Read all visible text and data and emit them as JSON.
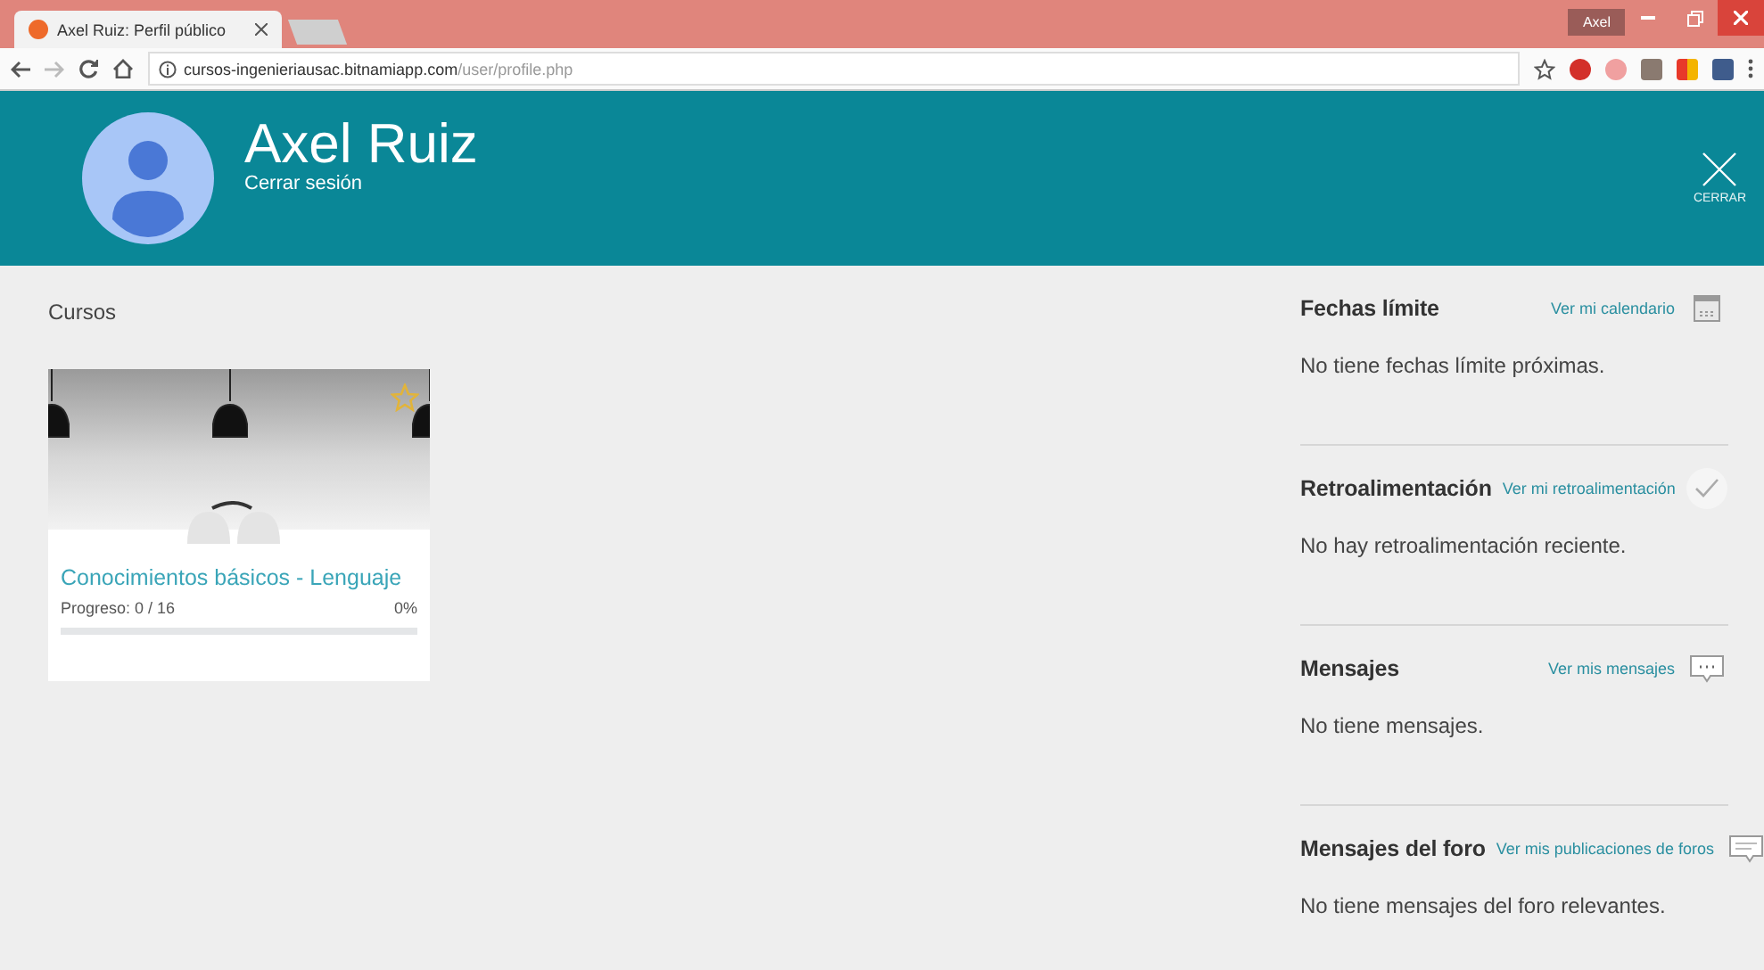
{
  "browser": {
    "tab_title": "Axel Ruiz: Perfil público",
    "user_badge": "Axel",
    "url_host": "cursos-ingenieriausac.bitnamiapp.com",
    "url_path": "/user/profile.php"
  },
  "header": {
    "name": "Axel Ruiz",
    "logout": "Cerrar sesión",
    "close": "CERRAR"
  },
  "courses": {
    "title": "Cursos",
    "items": [
      {
        "name": "Conocimientos básicos - Lenguaje",
        "progress_text": "Progreso: 0 / 16",
        "percent": "0%",
        "level": 0
      }
    ]
  },
  "blocks": [
    {
      "kind": "calendar",
      "title": "Fechas límite",
      "link": "Ver mi calendario",
      "message": "No tiene fechas límite próximas."
    },
    {
      "kind": "check",
      "title": "Retroalimentación",
      "link": "Ver mi retroalimentación",
      "message": "No hay retroalimentación reciente."
    },
    {
      "kind": "chat",
      "title": "Mensajes",
      "link": "Ver mis mensajes",
      "message": "No tiene mensajes."
    },
    {
      "kind": "forum",
      "title": "Mensajes del foro",
      "link": "Ver mis publicaciones de foros",
      "message": "No tiene mensajes del foro relevantes."
    }
  ]
}
